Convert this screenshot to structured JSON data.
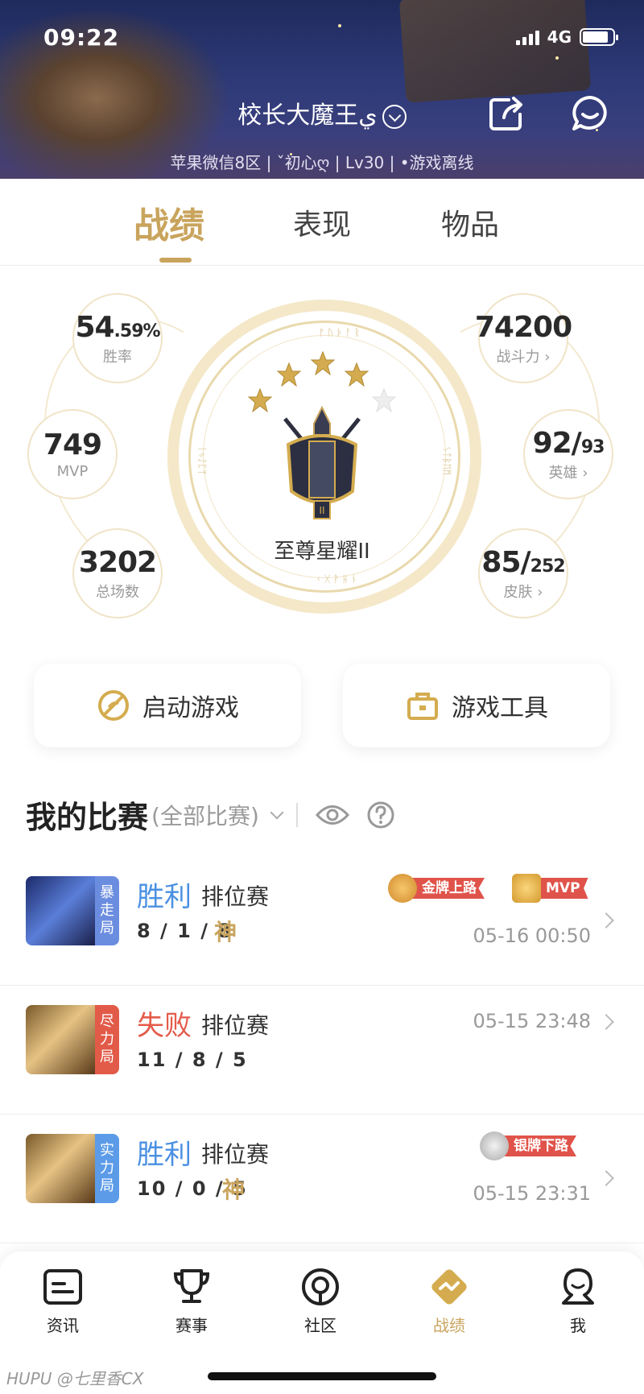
{
  "status_bar": {
    "time": "09:22",
    "network": "4G"
  },
  "profile": {
    "username": "校长大魔王ي",
    "subinfo": "苹果微信8区 | ˇ初心ღ | Lv30 | •游戏离线"
  },
  "tabs": [
    {
      "label": "战绩",
      "active": true
    },
    {
      "label": "表现",
      "active": false
    },
    {
      "label": "物品",
      "active": false
    }
  ],
  "stats": {
    "win_rate": {
      "main": "54",
      "decimal": ".59%",
      "label": "胜率"
    },
    "mvp": {
      "value": "749",
      "label": "MVP"
    },
    "total": {
      "value": "3202",
      "label": "总场数"
    },
    "power": {
      "value": "74200",
      "label": "战斗力 ›"
    },
    "heroes": {
      "main": "92/",
      "small": "93",
      "label": "英雄 ›"
    },
    "skins": {
      "main": "85/",
      "small": "252",
      "label": "皮肤 ›"
    }
  },
  "rank": {
    "name": "至尊星耀II",
    "stars_filled": 4,
    "stars_total": 5
  },
  "actions": {
    "launch": "启动游戏",
    "tools": "游戏工具"
  },
  "matches_section": {
    "title": "我的比赛",
    "filter": "(全部比赛)"
  },
  "matches": [
    {
      "result": "胜利",
      "mode": "排位赛",
      "kda": "8 / 1 / 8",
      "god": "神",
      "time": "05-16 00:50",
      "tag": [
        "暴",
        "走",
        "局"
      ],
      "badges": [
        "金牌上路",
        "MVP"
      ]
    },
    {
      "result": "失败",
      "mode": "排位赛",
      "kda": "11 / 8 / 5",
      "god": "",
      "time": "05-15 23:48",
      "tag": [
        "尽",
        "力",
        "局"
      ],
      "badges": []
    },
    {
      "result": "胜利",
      "mode": "排位赛",
      "kda": "10 / 0 / 5",
      "god": "神",
      "time": "05-15 23:31",
      "tag": [
        "实",
        "力",
        "局"
      ],
      "badges": [
        "银牌下路"
      ]
    }
  ],
  "colors": {
    "accent": "#c9a45d",
    "win": "#4a90e2",
    "loss": "#e45b4a",
    "gold_ribbon": "#e0534a"
  },
  "bottom_nav": [
    {
      "label": "资讯",
      "icon": "news-icon"
    },
    {
      "label": "赛事",
      "icon": "trophy-icon"
    },
    {
      "label": "社区",
      "icon": "community-icon"
    },
    {
      "label": "战绩",
      "icon": "record-icon",
      "active": true
    },
    {
      "label": "我",
      "icon": "profile-icon"
    }
  ],
  "watermark": "HUPU @七里香CX"
}
